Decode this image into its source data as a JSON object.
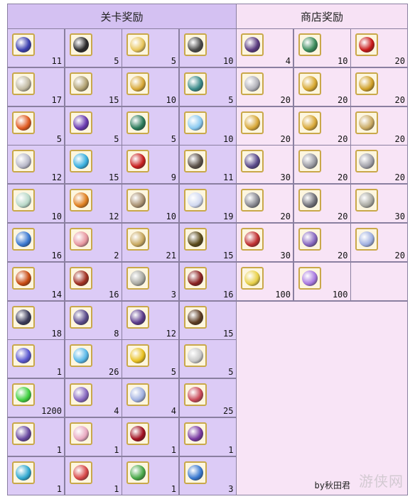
{
  "headers": {
    "level_rewards": "关卡奖励",
    "shop_rewards": "商店奖励"
  },
  "level_rewards": [
    {
      "qty": "11",
      "icon": "blue-gem-icon",
      "color": "#3b3fb0"
    },
    {
      "qty": "5",
      "icon": "black-fang-icon",
      "color": "#2a2a2a"
    },
    {
      "qty": "5",
      "icon": "gold-feather-icon",
      "color": "#e8c55a"
    },
    {
      "qty": "10",
      "icon": "iron-pot-icon",
      "color": "#4a4a4a"
    },
    {
      "qty": "17",
      "icon": "silver-vase-icon",
      "color": "#c0b8a0"
    },
    {
      "qty": "15",
      "icon": "gear-orb-icon",
      "color": "#b0a070"
    },
    {
      "qty": "10",
      "icon": "gold-lamp-icon",
      "color": "#d8a838"
    },
    {
      "qty": "5",
      "icon": "jeweled-brooch-icon",
      "color": "#3a8a8a"
    },
    {
      "qty": "5",
      "icon": "phoenix-feather-icon",
      "color": "#e05a20"
    },
    {
      "qty": "5",
      "icon": "purple-flower-icon",
      "color": "#6a3ab0"
    },
    {
      "qty": "5",
      "icon": "green-wing-icon",
      "color": "#2a7a5a"
    },
    {
      "qty": "10",
      "icon": "crystal-ball-icon",
      "color": "#88c8f0"
    },
    {
      "qty": "12",
      "icon": "silver-horn-icon",
      "color": "#b8b8c8"
    },
    {
      "qty": "15",
      "icon": "blue-lantern-icon",
      "color": "#3ab0e0"
    },
    {
      "qty": "9",
      "icon": "red-ornament-icon",
      "color": "#c82020"
    },
    {
      "qty": "11",
      "icon": "stone-medal-icon",
      "color": "#5a5048"
    },
    {
      "qty": "10",
      "icon": "parchment-icon",
      "color": "#b8d8c8"
    },
    {
      "qty": "12",
      "icon": "fire-flower-icon",
      "color": "#e08020"
    },
    {
      "qty": "10",
      "icon": "stone-cluster-icon",
      "color": "#a89070"
    },
    {
      "qty": "19",
      "icon": "white-crystal-icon",
      "color": "#d0d8f0"
    },
    {
      "qty": "16",
      "icon": "blue-feather-icon",
      "color": "#3a78d0"
    },
    {
      "qty": "2",
      "icon": "pink-shell-icon",
      "color": "#e898a0"
    },
    {
      "qty": "21",
      "icon": "golden-shell-icon",
      "color": "#c8a860"
    },
    {
      "qty": "15",
      "icon": "dark-mask-icon",
      "color": "#5a4a1a"
    },
    {
      "qty": "14",
      "icon": "flame-branch-icon",
      "color": "#c84a10"
    },
    {
      "qty": "16",
      "icon": "red-blossom-icon",
      "color": "#a03020"
    },
    {
      "qty": "3",
      "icon": "silver-leaf-icon",
      "color": "#a8a8a0"
    },
    {
      "qty": "16",
      "icon": "red-bone-icon",
      "color": "#8a2020"
    },
    {
      "qty": "18",
      "icon": "dark-claw-icon",
      "color": "#3a3a58"
    },
    {
      "qty": "8",
      "icon": "crescent-blade-icon",
      "color": "#5a4a8a"
    },
    {
      "qty": "12",
      "icon": "purple-shard-icon",
      "color": "#5a3a8a"
    },
    {
      "qty": "15",
      "icon": "bronze-tongs-icon",
      "color": "#5a3a20"
    },
    {
      "qty": "1",
      "icon": "spell-card-icon",
      "color": "#5a58d0"
    },
    {
      "qty": "26",
      "icon": "rainbow-star-icon",
      "color": "#58b8e8"
    },
    {
      "qty": "5",
      "icon": "gold-apple-icon",
      "color": "#e8c020"
    },
    {
      "qty": "5",
      "icon": "silver-apple-icon",
      "color": "#c8c8c8"
    },
    {
      "qty": "1200",
      "icon": "green-orb-icon",
      "color": "#40d040"
    },
    {
      "qty": "4",
      "icon": "servant-card-icon",
      "color": "#8868c0"
    },
    {
      "qty": "4",
      "icon": "silver-card-icon",
      "color": "#a0b0e0"
    },
    {
      "qty": "25",
      "icon": "rare-card-icon",
      "color": "#c84858"
    },
    {
      "qty": "1",
      "icon": "portrait-card-icon",
      "color": "#6848a0"
    },
    {
      "qty": "1",
      "icon": "pink-key-icon",
      "color": "#e8a8c0"
    },
    {
      "qty": "1",
      "icon": "crest-emblem-icon",
      "color": "#a01020"
    },
    {
      "qty": "1",
      "icon": "costume-card-icon",
      "color": "#7838a0"
    },
    {
      "qty": "1",
      "icon": "blue-key-icon",
      "color": "#30a8d0"
    },
    {
      "qty": "1",
      "icon": "red-key-icon",
      "color": "#d84848"
    },
    {
      "qty": "1",
      "icon": "green-key-icon",
      "color": "#48a848"
    },
    {
      "qty": "3",
      "icon": "blue-quill-icon",
      "color": "#3878d0"
    }
  ],
  "shop_rewards": [
    {
      "qty": "4",
      "icon": "purple-essence-icon",
      "color": "#5a3a80"
    },
    {
      "qty": "10",
      "icon": "green-scepter-icon",
      "color": "#3a8a5a"
    },
    {
      "qty": "20",
      "icon": "red-drop-icon",
      "color": "#c81818"
    },
    {
      "qty": "20",
      "icon": "silver-chain-icon",
      "color": "#b0b0b8"
    },
    {
      "qty": "20",
      "icon": "gold-statue-icon",
      "color": "#d8a830"
    },
    {
      "qty": "20",
      "icon": "gold-figure-icon",
      "color": "#d0a028"
    },
    {
      "qty": "20",
      "icon": "gold-idol-icon",
      "color": "#d8a838"
    },
    {
      "qty": "20",
      "icon": "gold-lamp-icon",
      "color": "#d8a838"
    },
    {
      "qty": "20",
      "icon": "golden-shell-icon",
      "color": "#c8a860"
    },
    {
      "qty": "30",
      "icon": "crescent-blade-icon",
      "color": "#5a4a8a"
    },
    {
      "qty": "20",
      "icon": "silver-statue-icon",
      "color": "#9898a0"
    },
    {
      "qty": "20",
      "icon": "silver-figure-icon",
      "color": "#a0a0a8"
    },
    {
      "qty": "20",
      "icon": "silver-idol-icon",
      "color": "#888890"
    },
    {
      "qty": "20",
      "icon": "iron-ring-icon",
      "color": "#707078"
    },
    {
      "qty": "30",
      "icon": "silver-leaf-icon",
      "color": "#a8a8a0"
    },
    {
      "qty": "30",
      "icon": "red-quill-icon",
      "color": "#c03030"
    },
    {
      "qty": "20",
      "icon": "servant-card-icon",
      "color": "#8868c0"
    },
    {
      "qty": "20",
      "icon": "silver-card-icon",
      "color": "#a0b0e0"
    },
    {
      "qty": "100",
      "icon": "gold-card-icon",
      "color": "#e8d048"
    },
    {
      "qty": "100",
      "icon": "rainbow-card-icon",
      "color": "#a878e0"
    }
  ],
  "credit": "by秋田君",
  "watermark": "游侠网"
}
